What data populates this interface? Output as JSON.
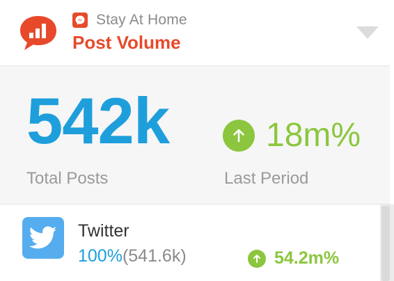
{
  "header": {
    "context_label": "Stay At Home",
    "title": "Post Volume",
    "app_icon": "chat-bar-chart-icon",
    "context_icon": "messenger-icon",
    "dropdown_icon": "triangle-down-icon"
  },
  "stats": {
    "total_value": "542k",
    "total_label": "Total Posts",
    "change_value": "18m%",
    "change_label": "Last Period",
    "change_icon": "arrow-up-circle-icon"
  },
  "networks": [
    {
      "name": "Twitter",
      "icon": "twitter-icon",
      "share_pct": "100%",
      "share_count": "(541.6k)",
      "change": "54.2m%"
    }
  ],
  "colors": {
    "brand_orange": "#e8492b",
    "primary_blue": "#1e9fdc",
    "positive_green": "#8cc63e",
    "twitter_blue": "#55acee",
    "muted_gray": "#9a9a9a"
  }
}
